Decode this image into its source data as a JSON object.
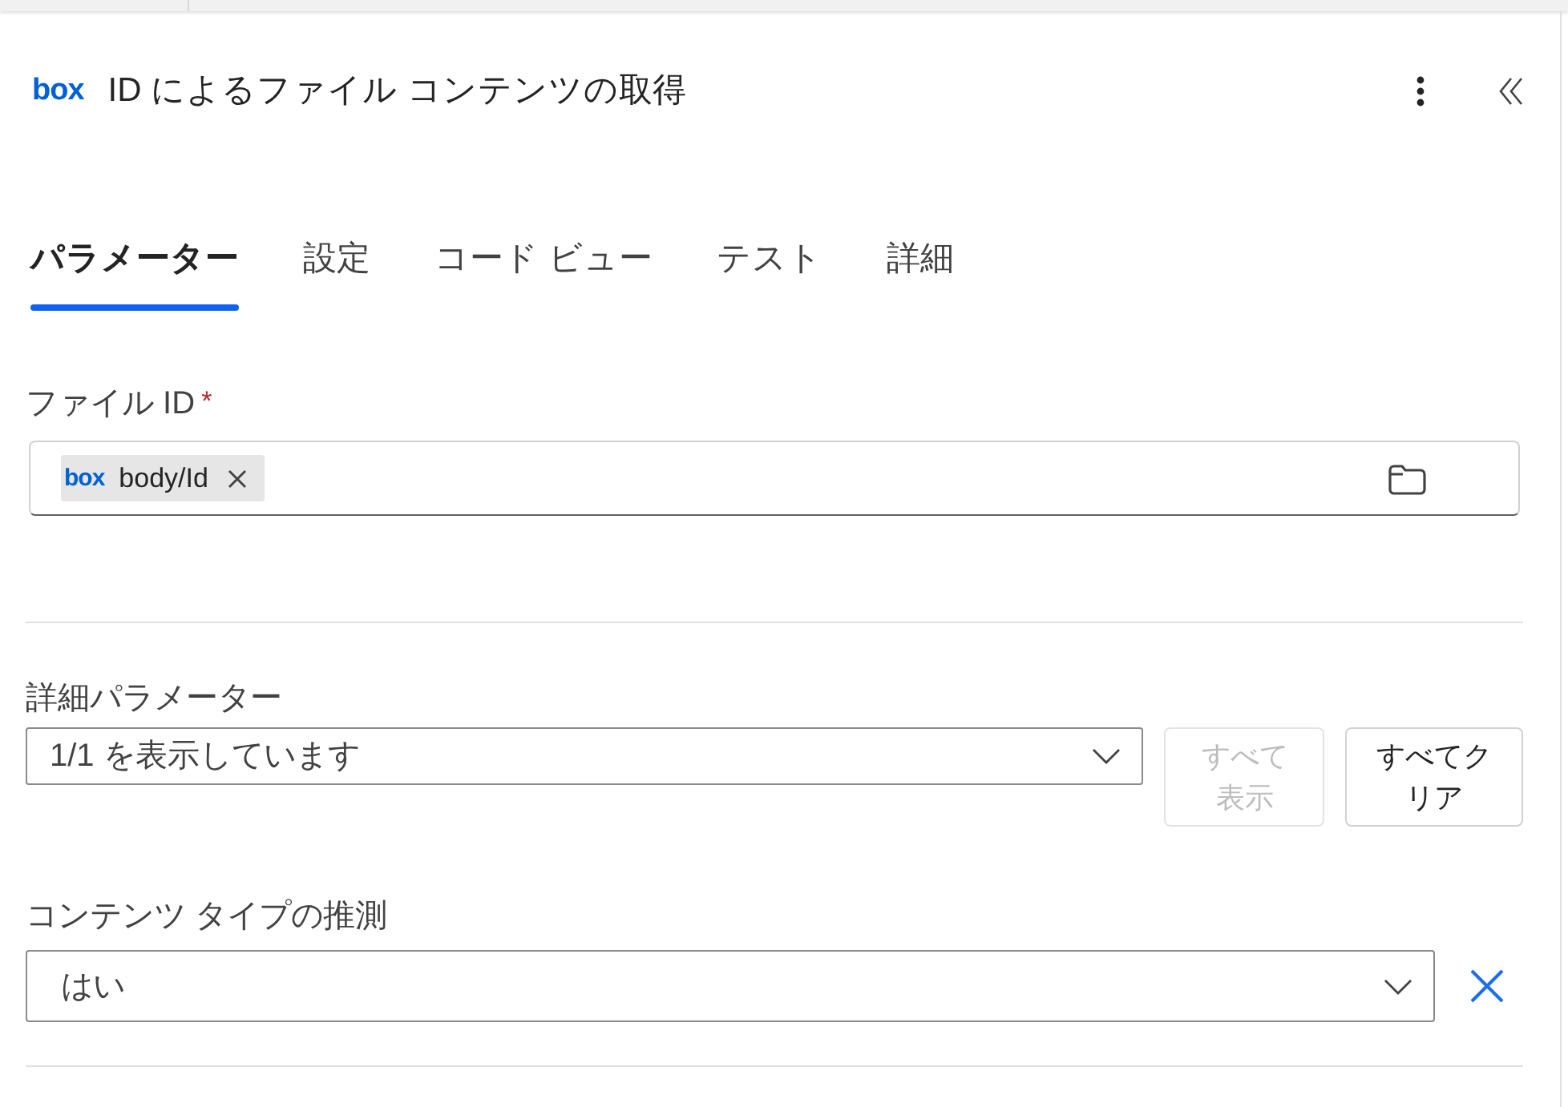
{
  "header": {
    "logo": "box",
    "title": "ID によるファイル コンテンツの取得"
  },
  "tabs": [
    {
      "label": "パラメーター",
      "selected": true
    },
    {
      "label": "設定",
      "selected": false
    },
    {
      "label": "コード ビュー",
      "selected": false
    },
    {
      "label": "テスト",
      "selected": false
    },
    {
      "label": "詳細",
      "selected": false
    }
  ],
  "file_id": {
    "label": "ファイル ID",
    "required_mark": "*",
    "token": {
      "logo": "box",
      "text": "body/Id"
    }
  },
  "advanced_parameters": {
    "label": "詳細パラメーター",
    "value": "1/1 を表示しています",
    "buttons": [
      {
        "label": "すべて表示",
        "disabled": true
      },
      {
        "label": "すべてクリア",
        "disabled": false
      }
    ]
  },
  "parameters": [
    {
      "label": "コンテンツ タイプの推測",
      "value": "はい"
    }
  ]
}
